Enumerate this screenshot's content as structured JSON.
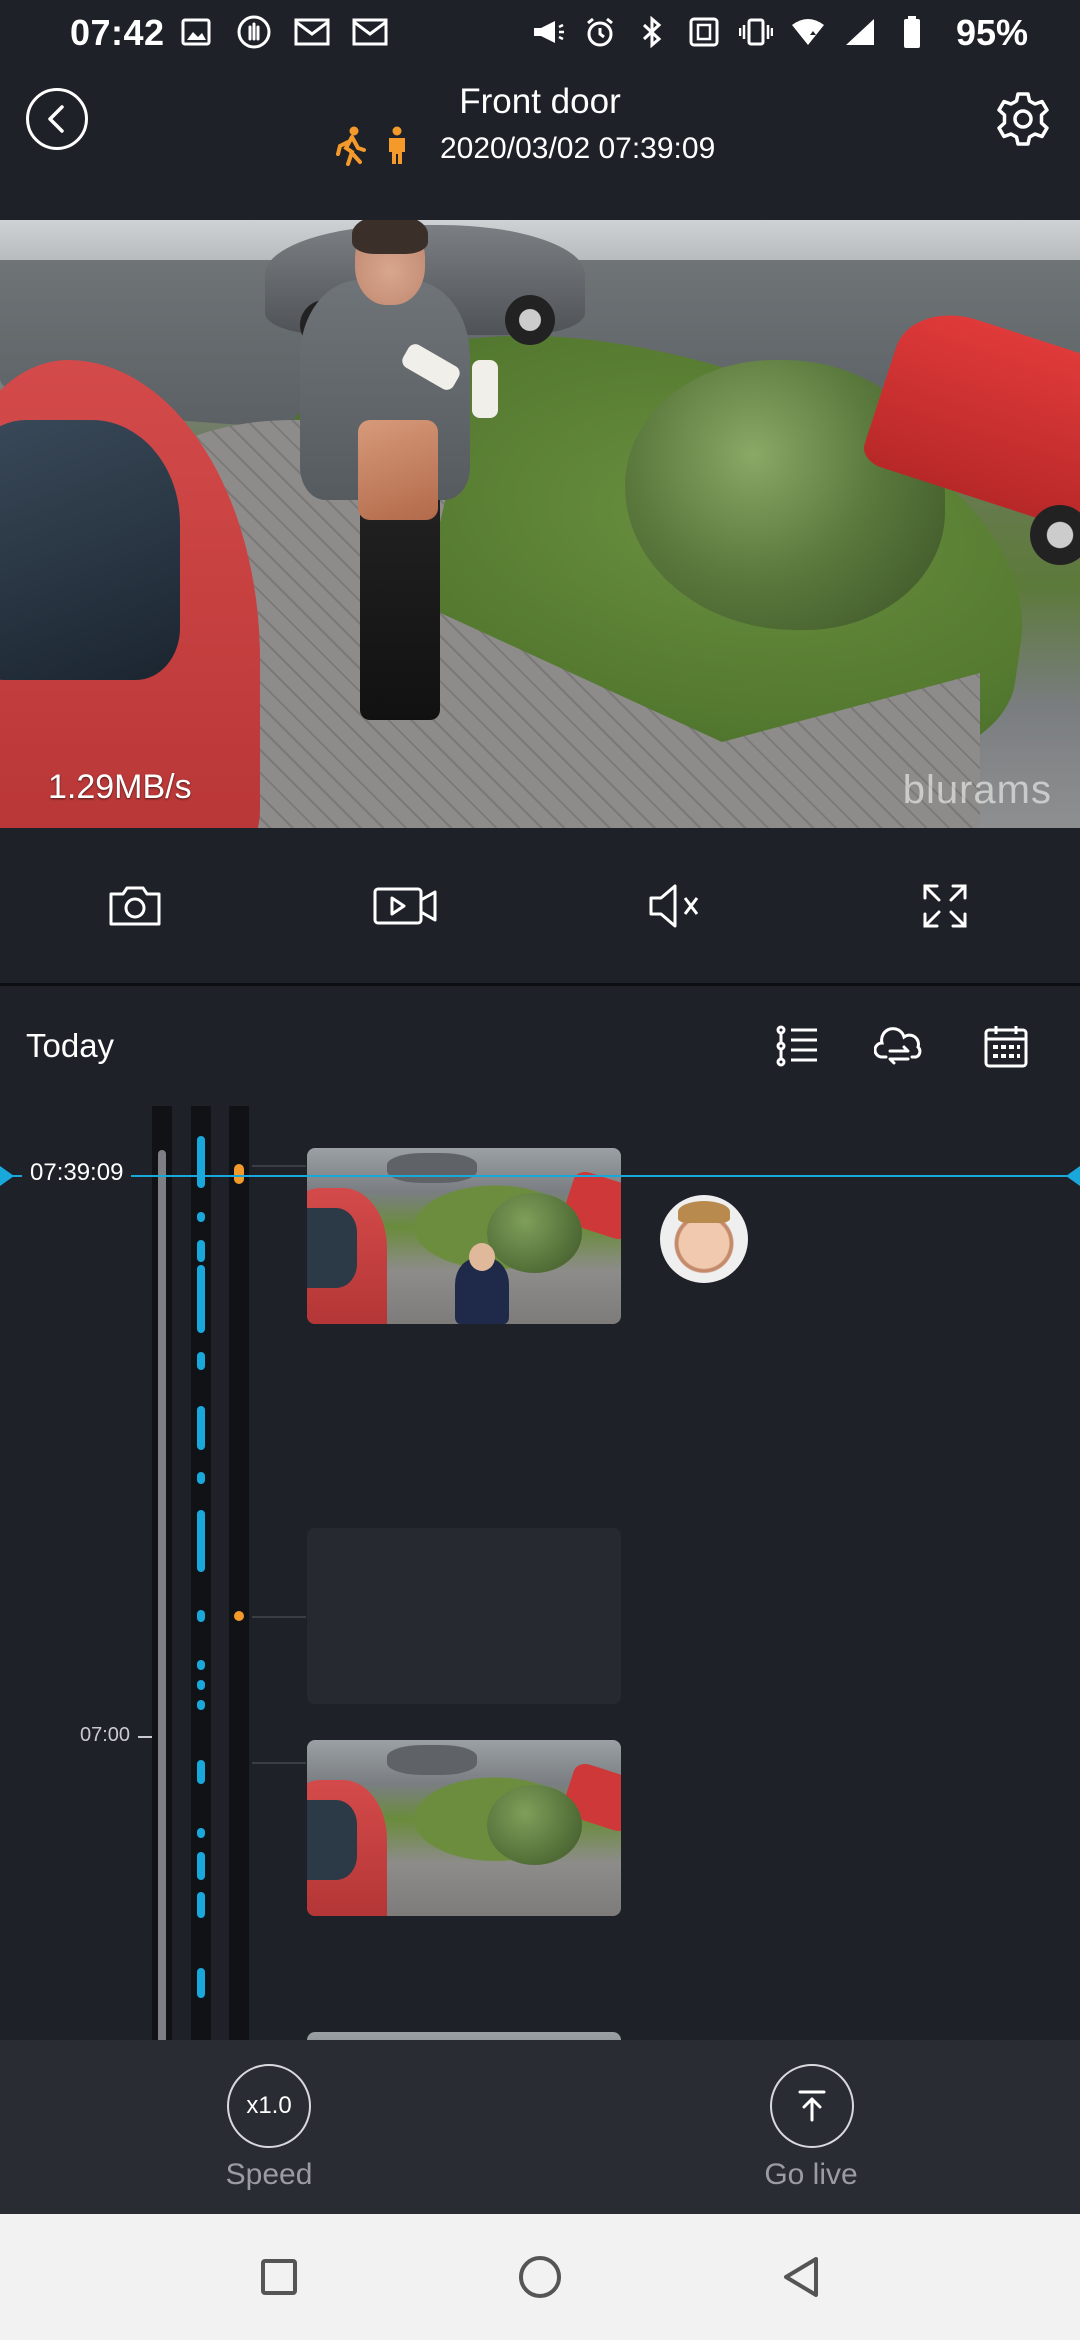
{
  "status_bar": {
    "time": "07:42",
    "battery": "95%"
  },
  "header": {
    "title": "Front door",
    "timestamp": "2020/03/02 07:39:09"
  },
  "video": {
    "data_rate": "1.29MB/s",
    "brand": "blurams"
  },
  "timeline": {
    "date_label": "Today",
    "cursor_time": "07:39:09",
    "tick_label": "07:00"
  },
  "bottom": {
    "speed_value": "x1.0",
    "speed_label": "Speed",
    "live_label": "Go live"
  },
  "colors": {
    "accent_blue": "#19a8db",
    "event_orange": "#f39a2b",
    "background": "#1f2128"
  }
}
